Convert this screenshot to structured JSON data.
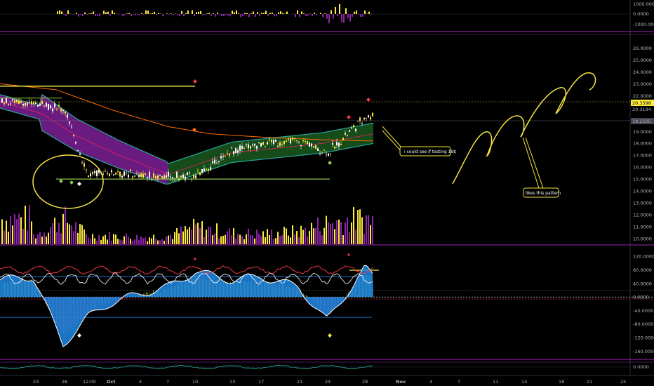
{
  "colors": {
    "background": "#000000",
    "pane_border": "#9c27b0",
    "up": "#ffeb3b",
    "down": "#ffffff",
    "line_yellow": "#f5e342",
    "line_green": "#8bc34a",
    "line_orange": "#ff6d00",
    "band_purple": "#8e24aa",
    "band_green": "#1b5e20",
    "teal": "#26a69a",
    "red": "#f23645",
    "blue": "#1e88e5"
  },
  "x_axis": {
    "ticks": [
      "23",
      "26",
      "12:00",
      "Oct",
      "4",
      "7",
      "10",
      "13",
      "17",
      "21",
      "24",
      "28",
      "Nov",
      "4",
      "7",
      "11",
      "14",
      "18",
      "21",
      "25"
    ]
  },
  "panes": {
    "top_oscillator": {
      "ticks": [
        "1000.0000",
        "0.0000",
        "-1000.0000"
      ]
    },
    "price": {
      "ticks": [
        "26.0000",
        "25.0000",
        "24.0000",
        "23.0000",
        "22.0000",
        "21.0000",
        "20.0000",
        "19.0000",
        "18.0000",
        "17.0000",
        "16.0000",
        "15.0000",
        "14.0000",
        "13.0000",
        "12.0000",
        "11.0000",
        "10.0000"
      ],
      "price_labels": [
        "20.3598",
        "20.3194",
        "19.2505"
      ]
    },
    "wave_oscillator": {
      "ticks": [
        "120.0000",
        "80.0000",
        "40.0000",
        "0.0000",
        "-40.0000",
        "-80.0000",
        "-120.0000",
        "-160.0000"
      ]
    },
    "bottom_oscillator": {
      "ticks": [
        "0.0000"
      ]
    }
  },
  "annotations": {
    "callout_1": "i could see if testing 19$",
    "callout_2": "likes this pattern"
  },
  "chart_data": [
    {
      "type": "candlestick",
      "pane": "price",
      "ylim": [
        10,
        26.5
      ],
      "x": [
        "23",
        "26",
        "12:00",
        "Oct",
        "4",
        "7",
        "10",
        "13",
        "17",
        "21",
        "24",
        "28"
      ],
      "series": [
        {
          "values": [
            21.4,
            20.9,
            15.3,
            15.6,
            15.3,
            15.2,
            15.2,
            17.4,
            18.0,
            18.2,
            17.2,
            20.2
          ]
        }
      ],
      "horizontal_lines": [
        22.8,
        15.0
      ]
    },
    {
      "type": "bar",
      "pane": "price-volume",
      "x": [
        "23",
        "26",
        "12:00",
        "Oct",
        "4",
        "7",
        "10",
        "13",
        "17",
        "21",
        "24",
        "28"
      ],
      "values": [
        1,
        3,
        1,
        1,
        0.8,
        1,
        2,
        1.3,
        1.2,
        1.5,
        2.5,
        3
      ]
    },
    {
      "type": "line",
      "pane": "wave_oscillator",
      "ylim": [
        -180,
        135
      ],
      "x": [
        "23",
        "26",
        "12:00",
        "Oct",
        "4",
        "7",
        "10",
        "13",
        "17",
        "21",
        "24",
        "28"
      ],
      "series": [
        {
          "values": [
            60,
            -140,
            -60,
            -20,
            10,
            30,
            75,
            50,
            60,
            30,
            -70,
            85
          ]
        }
      ]
    }
  ]
}
